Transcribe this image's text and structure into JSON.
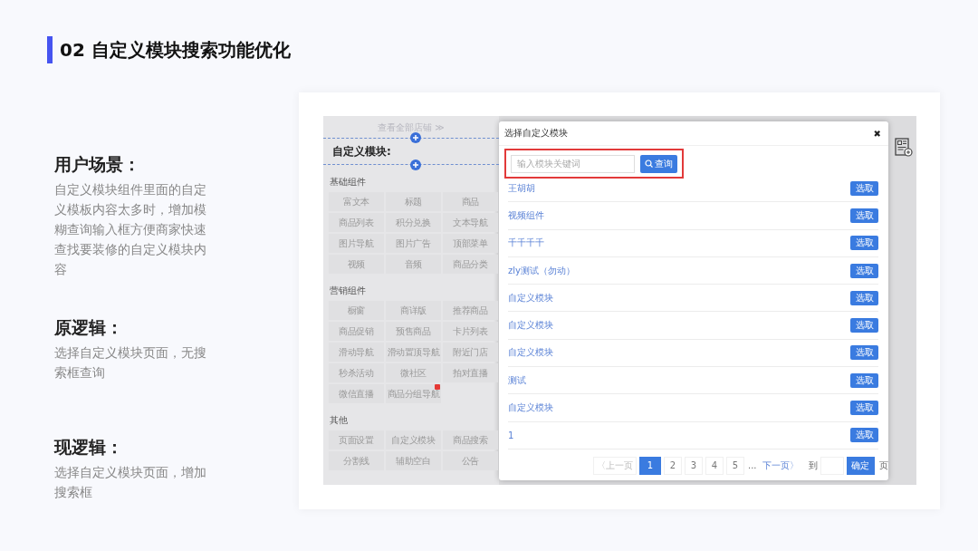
{
  "title": "02 自定义模块搜索功能优化",
  "sections": [
    {
      "heading": "用户场景：",
      "body": "自定义模块组件里面的自定义模板内容太多时，增加模糊查询输入框方便商家快速查找要装修的自定义模块内容"
    },
    {
      "heading": "原逻辑：",
      "body": "选择自定义模块页面，无搜索框查询"
    },
    {
      "heading": "现逻辑：",
      "body": "选择自定义模块页面，增加搜索框"
    }
  ],
  "editor": {
    "link": "查看全部店铺 ≫",
    "module_title": "自定义模块:",
    "groups": [
      {
        "name": "基础组件",
        "items": [
          {
            "label": "富文本",
            "badge": false
          },
          {
            "label": "标题",
            "badge": false
          },
          {
            "label": "商品",
            "badge": false
          },
          {
            "label": "商品列表",
            "badge": false
          },
          {
            "label": "积分兑换",
            "badge": false
          },
          {
            "label": "文本导航",
            "badge": false
          },
          {
            "label": "图片导航",
            "badge": false
          },
          {
            "label": "图片广告",
            "badge": false
          },
          {
            "label": "顶部菜单",
            "badge": false
          },
          {
            "label": "视频",
            "badge": false
          },
          {
            "label": "音频",
            "badge": false
          },
          {
            "label": "商品分类",
            "badge": false
          }
        ]
      },
      {
        "name": "营销组件",
        "items": [
          {
            "label": "橱窗",
            "badge": false
          },
          {
            "label": "商详版",
            "badge": false
          },
          {
            "label": "推荐商品",
            "badge": false
          },
          {
            "label": "商品促销",
            "badge": false
          },
          {
            "label": "预售商品",
            "badge": false
          },
          {
            "label": "卡片列表",
            "badge": false
          },
          {
            "label": "滑动导航",
            "badge": false
          },
          {
            "label": "滑动置顶导航",
            "badge": false
          },
          {
            "label": "附近门店",
            "badge": false
          },
          {
            "label": "秒杀活动",
            "badge": false
          },
          {
            "label": "微社区",
            "badge": false
          },
          {
            "label": "拍对直播",
            "badge": false
          },
          {
            "label": "微信直播",
            "badge": false
          },
          {
            "label": "商品分组导航",
            "badge": true
          }
        ]
      },
      {
        "name": "其他",
        "items": [
          {
            "label": "页面设置",
            "badge": false
          },
          {
            "label": "自定义模块",
            "badge": false
          },
          {
            "label": "商品搜索",
            "badge": false
          },
          {
            "label": "分割线",
            "badge": false
          },
          {
            "label": "辅助空白",
            "badge": false
          },
          {
            "label": "公告",
            "badge": false
          }
        ]
      }
    ]
  },
  "modal": {
    "title": "选择自定义模块",
    "close": "✖",
    "search": {
      "placeholder": "输入模块关键词",
      "button": "查询"
    },
    "rows": [
      {
        "name": "王胡胡",
        "action": "选取"
      },
      {
        "name": "视频组件",
        "action": "选取"
      },
      {
        "name": "千千千千",
        "action": "选取"
      },
      {
        "name": "zly测试（勿动）",
        "action": "选取"
      },
      {
        "name": "自定义模块",
        "action": "选取"
      },
      {
        "name": "自定义模块",
        "action": "选取"
      },
      {
        "name": "自定义模块",
        "action": "选取"
      },
      {
        "name": "测试",
        "action": "选取"
      },
      {
        "name": "自定义模块",
        "action": "选取"
      },
      {
        "name": "1",
        "action": "选取"
      }
    ],
    "pagination": {
      "prev": "〈上一页",
      "pages": [
        {
          "label": "1",
          "selected": true
        },
        {
          "label": "2",
          "selected": false
        },
        {
          "label": "3",
          "selected": false
        },
        {
          "label": "4",
          "selected": false
        },
        {
          "label": "5",
          "selected": false
        }
      ],
      "ellipsis": "...",
      "next": "下一页〉",
      "goto": "到",
      "confirm": "确定",
      "suffix": "页"
    }
  }
}
